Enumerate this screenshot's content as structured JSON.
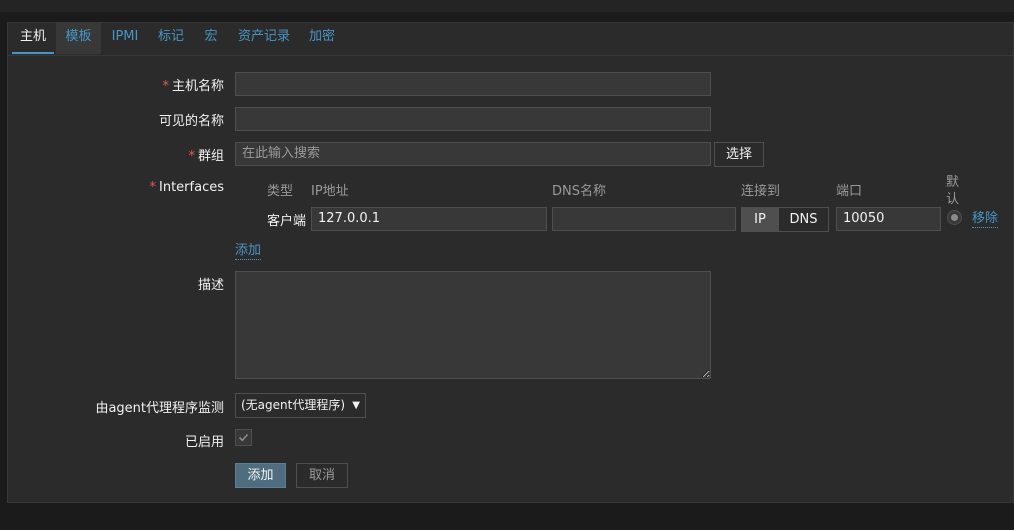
{
  "tabs": [
    {
      "label": "主机"
    },
    {
      "label": "模板"
    },
    {
      "label": "IPMI"
    },
    {
      "label": "标记"
    },
    {
      "label": "宏"
    },
    {
      "label": "资产记录"
    },
    {
      "label": "加密"
    }
  ],
  "form": {
    "required_mark": "*",
    "host_name": {
      "label": "主机名称",
      "value": ""
    },
    "visible_name": {
      "label": "可见的名称",
      "value": ""
    },
    "groups": {
      "label": "群组",
      "placeholder": "在此输入搜索",
      "select_button": "选择"
    },
    "interfaces": {
      "label": "Interfaces",
      "headers": {
        "type": "类型",
        "ip": "IP地址",
        "dns": "DNS名称",
        "connect_to": "连接到",
        "port": "端口",
        "default_line1": "默",
        "default_line2": "认"
      },
      "rows": [
        {
          "type": "客户端",
          "ip": "127.0.0.1",
          "dns": "",
          "connect_options": [
            "IP",
            "DNS"
          ],
          "connect_selected": "IP",
          "port": "10050",
          "remove_link": "移除"
        }
      ],
      "add_link": "添加"
    },
    "description": {
      "label": "描述",
      "value": ""
    },
    "monitored_by_proxy": {
      "label": "由agent代理程序监测",
      "selected": "(无agent代理程序)"
    },
    "enabled": {
      "label": "已启用",
      "checked": true
    },
    "buttons": {
      "add": "添加",
      "cancel": "取消"
    }
  },
  "colors": {
    "accent": "#4796c4",
    "required": "#e45959",
    "background": "#2b2b2b"
  }
}
